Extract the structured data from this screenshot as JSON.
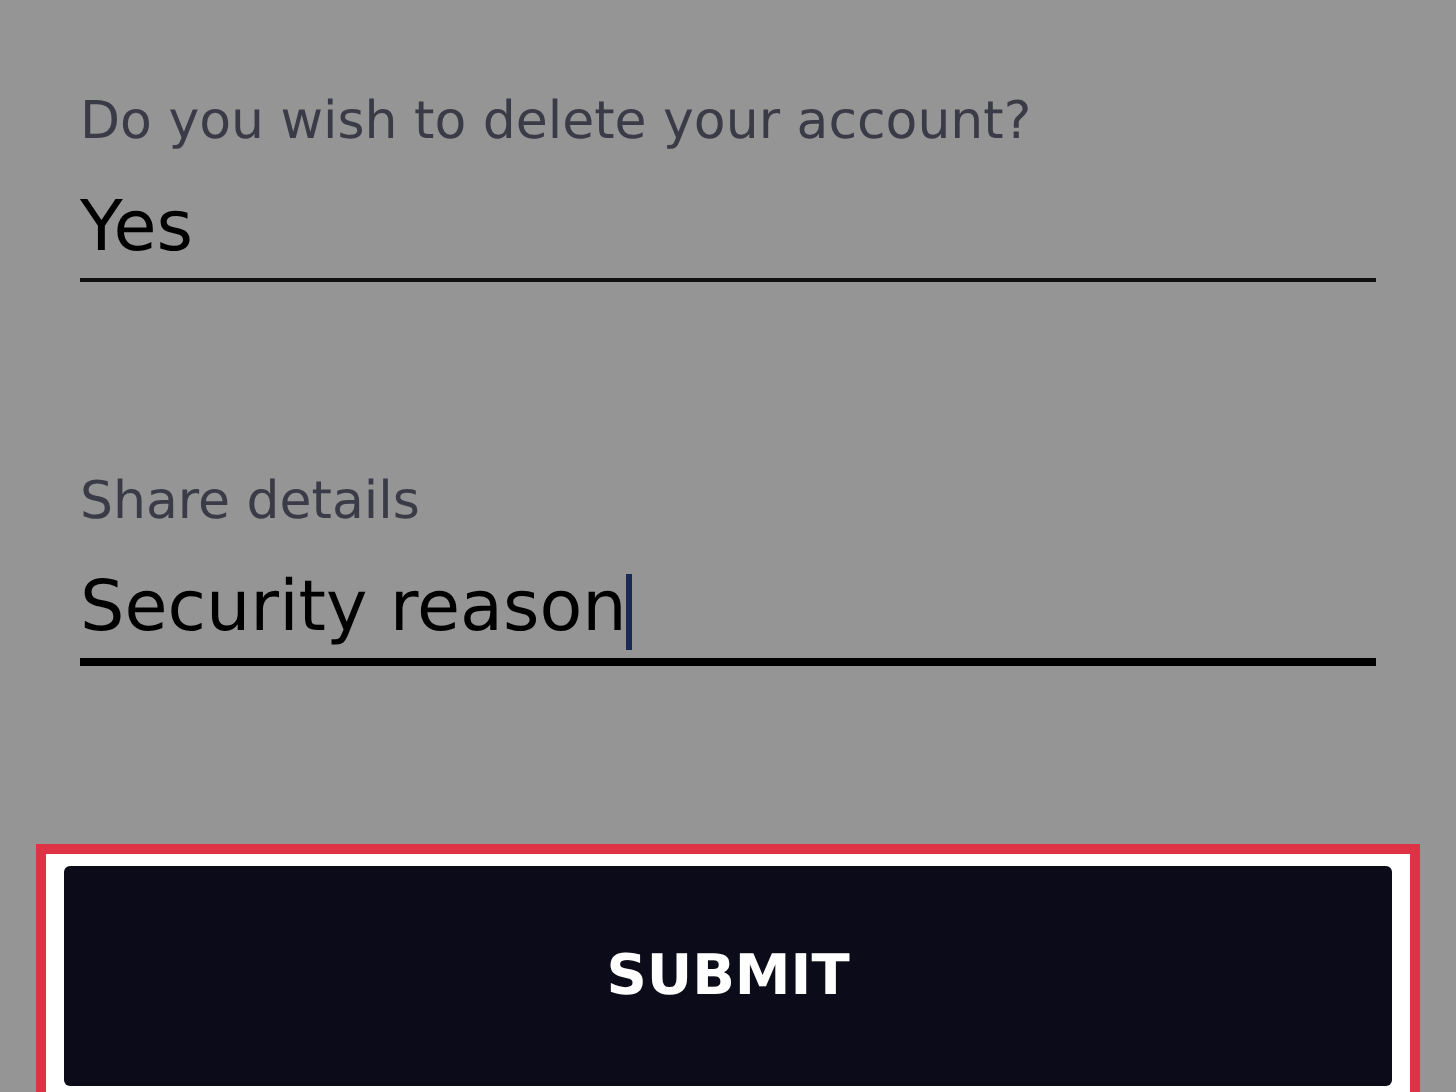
{
  "fields": [
    {
      "label": "Do you wish to delete your account?",
      "value": "Yes",
      "focused": false
    },
    {
      "label": "Share details",
      "value": "Security reason",
      "focused": true
    }
  ],
  "submit": {
    "label": "SUBMIT",
    "highlighted": true
  }
}
